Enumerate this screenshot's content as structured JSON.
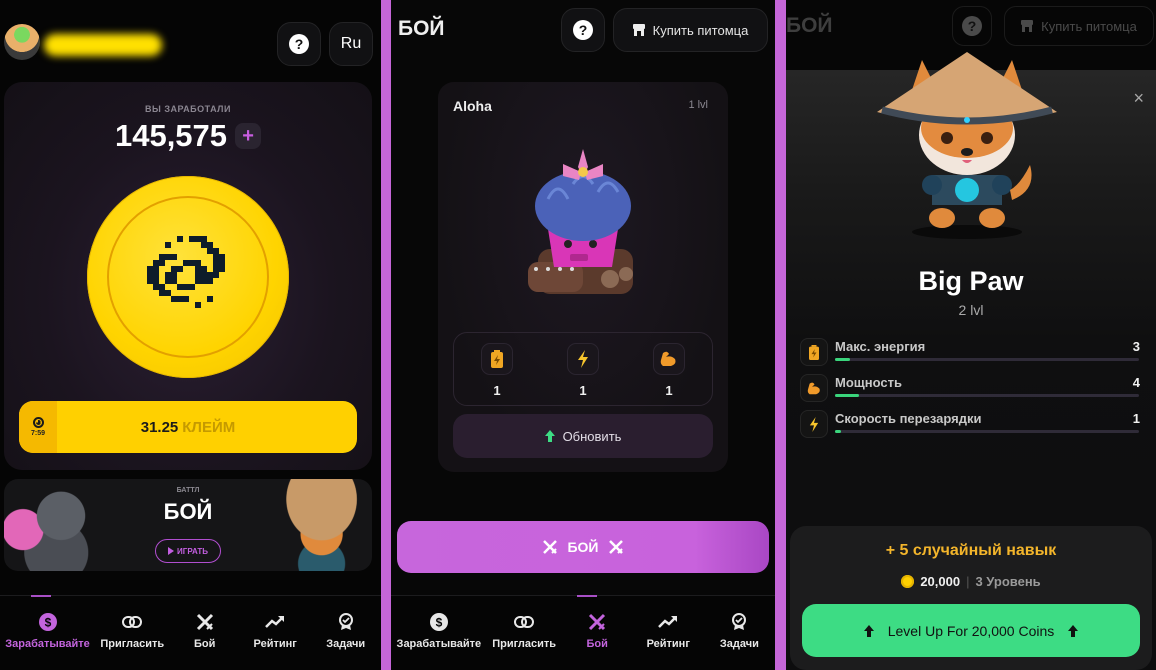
{
  "colors": {
    "divider": "#c566d8",
    "accent_purple": "#c364dd",
    "coin_yellow": "#ffd000",
    "progress_green": "#3ad57c",
    "levelup_green": "#3ddc84",
    "reward_gold": "#f3b52b"
  },
  "panel1": {
    "header": {
      "help_icon": "?",
      "language": "Ru"
    },
    "earnings": {
      "label": "ВЫ ЗАРАБОТАЛИ",
      "value": "145,575",
      "plus": "+"
    },
    "claim": {
      "timer": "7:59",
      "amount": "31.25",
      "label": "КЛЕЙМ"
    },
    "battle_banner": {
      "kicker": "БАТТЛ",
      "title": "БОЙ",
      "play_label": "ИГРАТЬ"
    },
    "nav": [
      {
        "label": "Зарабатывайте",
        "icon": "dollar-icon",
        "active": true
      },
      {
        "label": "Пригласить",
        "icon": "link-icon",
        "active": false
      },
      {
        "label": "Бой",
        "icon": "crossed-swords-icon",
        "active": false
      },
      {
        "label": "Рейтинг",
        "icon": "trend-up-icon",
        "active": false
      },
      {
        "label": "Задачи",
        "icon": "badge-check-icon",
        "active": false
      }
    ]
  },
  "panel2": {
    "title": "БОЙ",
    "help_icon": "?",
    "buy_pet_label": "Купить питомца",
    "pet": {
      "name": "Aloha",
      "level": "1 lvl",
      "stats": [
        {
          "icon": "battery-icon",
          "value": "1"
        },
        {
          "icon": "lightning-icon",
          "value": "1"
        },
        {
          "icon": "muscle-icon",
          "value": "1"
        }
      ],
      "upgrade_label": "Обновить"
    },
    "fight_label": "БОЙ",
    "nav": [
      {
        "label": "Зарабатывайте",
        "icon": "dollar-icon",
        "active": false
      },
      {
        "label": "Пригласить",
        "icon": "link-icon",
        "active": false
      },
      {
        "label": "Бой",
        "icon": "crossed-swords-icon",
        "active": true
      },
      {
        "label": "Рейтинг",
        "icon": "trend-up-icon",
        "active": false
      },
      {
        "label": "Задачи",
        "icon": "badge-check-icon",
        "active": false
      }
    ]
  },
  "panel3": {
    "background_title": "БОЙ",
    "background_help": "?",
    "background_buy_label": "Купить питомца",
    "close_icon": "×",
    "pet": {
      "name": "Big Paw",
      "level": "2 lvl"
    },
    "skills": [
      {
        "name": "Макс. энергия",
        "value": "3",
        "icon": "battery-icon",
        "progress": 0.05
      },
      {
        "name": "Мощность",
        "value": "4",
        "icon": "muscle-icon",
        "progress": 0.08
      },
      {
        "name": "Скорость перезарядки",
        "value": "1",
        "icon": "lightning-icon",
        "progress": 0.02
      }
    ],
    "reward": {
      "title": "+ 5 случайный навык",
      "price": "20,000",
      "separator": "|",
      "next_level": "3 Уровень",
      "levelup_label": "Level Up For 20,000 Coins"
    }
  }
}
